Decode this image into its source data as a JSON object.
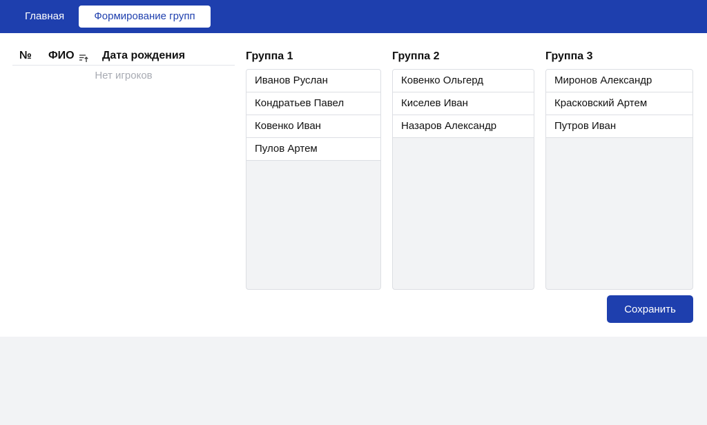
{
  "nav": {
    "home_label": "Главная",
    "groups_label": "Формирование групп"
  },
  "players_table": {
    "columns": [
      "№",
      "ФИО",
      "Дата рождения"
    ],
    "sort_icon": "sort-ascending-icon",
    "empty_text": "Нет игроков"
  },
  "groups": [
    {
      "title": "Группа 1",
      "members": [
        "Иванов Руслан",
        "Кондратьев Павел",
        "Ковенко Иван",
        "Пулов Артем"
      ]
    },
    {
      "title": "Группа 2",
      "members": [
        "Ковенко Ольгерд",
        "Киселев Иван",
        "Назаров Александр"
      ]
    },
    {
      "title": "Группа 3",
      "members": [
        "Миронов Александр",
        "Красковский Артем",
        "Путров Иван"
      ]
    }
  ],
  "save_label": "Сохранить",
  "colors": {
    "accent": "#1e3fae",
    "page_bg": "#f2f3f5",
    "muted_text": "#a8abb3"
  }
}
